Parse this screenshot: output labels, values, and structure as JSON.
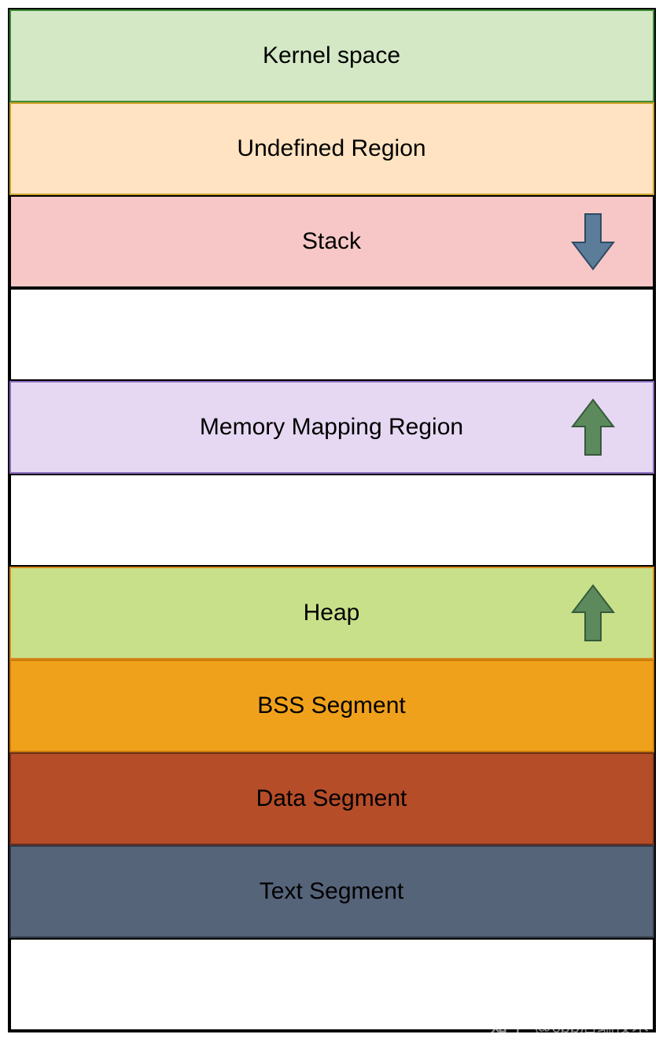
{
  "segments": {
    "kernel": "Kernel space",
    "undefined": "Undefined Region",
    "stack": "Stack",
    "gap1": "",
    "mmap": "Memory Mapping Region",
    "gap2": "",
    "heap": "Heap",
    "bss": "BSS Segment",
    "data": "Data Segment",
    "text": "Text Segment",
    "bottom": ""
  },
  "arrows": {
    "stack_direction": "down",
    "mmap_direction": "up",
    "heap_direction": "up"
  },
  "colors": {
    "kernel_bg": "#d4e8c6",
    "undefined_bg": "#ffe3c2",
    "stack_bg": "#f6c7c6",
    "mmap_bg": "#e6d8f2",
    "heap_bg": "#c8e08a",
    "bss_bg": "#f0a11c",
    "data_bg": "#b54d29",
    "text_bg": "#56647a",
    "arrow_down_fill": "#5b7d99",
    "arrow_up_fill": "#5c8a5c"
  },
  "watermark": {
    "brand": "知乎",
    "handle": "@cpp后端技术"
  }
}
